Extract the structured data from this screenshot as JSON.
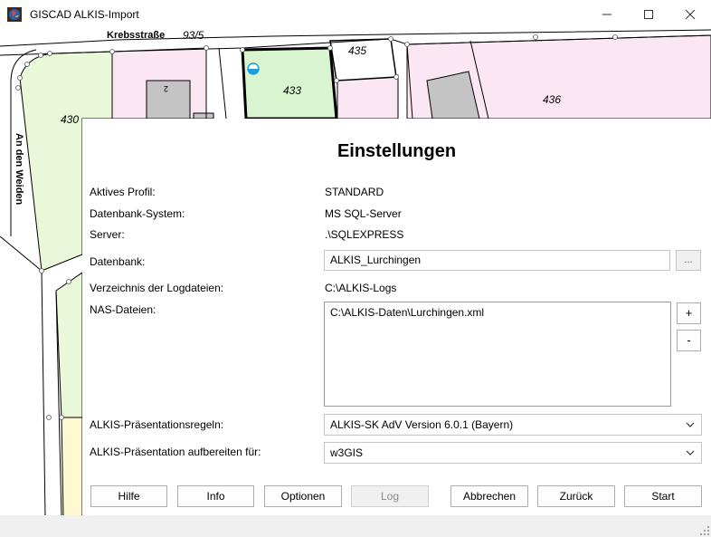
{
  "window": {
    "title": "GISCAD ALKIS-Import",
    "minimize_icon": "minimize-icon",
    "maximize_icon": "maximize-icon",
    "close_icon": "close-icon"
  },
  "map": {
    "street_top": "Krebsstraße",
    "street_side": "An den Weiden",
    "parcels": {
      "p93_5": "93/5",
      "p435": "435",
      "p433": "433",
      "p436": "436",
      "p430": "430",
      "house_no": "2"
    }
  },
  "dialog": {
    "title": "Einstellungen",
    "fields": {
      "profile_label": "Aktives Profil:",
      "profile_value": "STANDARD",
      "dbsystem_label": "Datenbank-System:",
      "dbsystem_value": "MS SQL-Server",
      "server_label": "Server:",
      "server_value": ".\\SQLEXPRESS",
      "database_label": "Datenbank:",
      "database_value": "ALKIS_Lurchingen",
      "browse_label": "...",
      "logdir_label": "Verzeichnis der Logdateien:",
      "logdir_value": "C:\\ALKIS-Logs",
      "nas_label": "NAS-Dateien:",
      "nas_files": [
        "C:\\ALKIS-Daten\\Lurchingen.xml"
      ],
      "add_label": "+",
      "remove_label": "-",
      "rules_label": "ALKIS-Präsentationsregeln:",
      "rules_value": "ALKIS-SK AdV Version 6.0.1 (Bayern)",
      "target_label": "ALKIS-Präsentation aufbereiten für:",
      "target_value": "w3GIS"
    },
    "buttons": {
      "help": "Hilfe",
      "info": "Info",
      "options": "Optionen",
      "log": "Log",
      "cancel": "Abbrechen",
      "back": "Zurück",
      "start": "Start"
    }
  },
  "colors": {
    "parcel_green": "#e8f8d8",
    "parcel_pink": "#fbe6f3",
    "building_gray": "#c4c4c4",
    "highlight_green": "#d8f5d0",
    "yellow_area": "#fff8d0"
  }
}
